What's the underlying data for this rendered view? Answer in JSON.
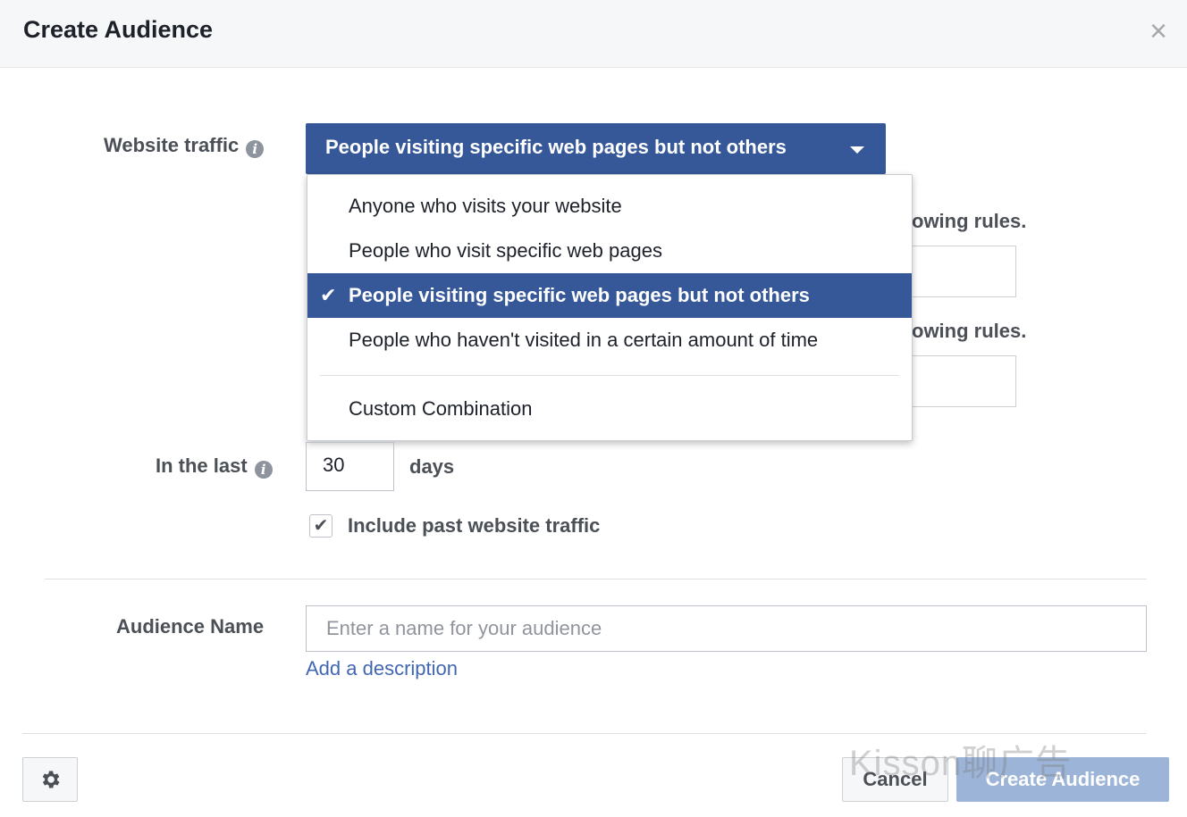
{
  "dialog": {
    "title": "Create Audience",
    "close_glyph": "×"
  },
  "website_traffic": {
    "label": "Website traffic",
    "selected": "People visiting specific web pages but not others",
    "options": [
      "Anyone who visits your website",
      "People who visit specific web pages",
      "People visiting specific web pages but not others",
      "People who haven't visited in a certain amount of time",
      "Custom Combination"
    ],
    "selected_index": 2,
    "check_glyph": "✔"
  },
  "background": {
    "rules_text_1": "owing rules.",
    "rules_text_2": "owing rules."
  },
  "in_the_last": {
    "label": "In the last",
    "value": "30",
    "unit": "days"
  },
  "include_past": {
    "label": "Include past website traffic",
    "checked": true,
    "check_glyph": "✔"
  },
  "audience_name": {
    "label": "Audience Name",
    "placeholder": "Enter a name for your audience",
    "add_description": "Add a description"
  },
  "footer": {
    "cancel_label": "Cancel",
    "create_label": "Create Audience"
  },
  "watermark": "Kisson聊广告",
  "colors": {
    "accent": "#365899",
    "link": "#4267b2",
    "disabled_button": "#9cb4d8"
  },
  "icons": {
    "info": "info-icon",
    "gear": "gear-icon",
    "close": "close-icon",
    "caret": "caret-down-icon"
  }
}
